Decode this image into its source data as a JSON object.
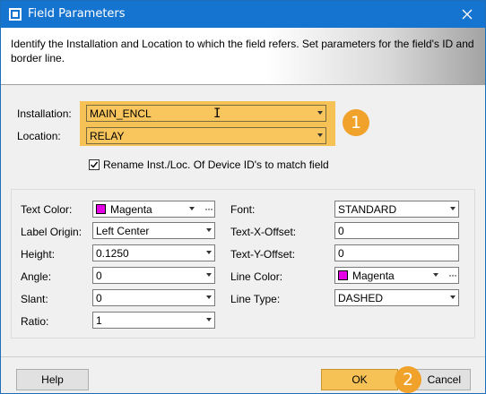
{
  "window": {
    "title": "Field Parameters",
    "description": "Identify the Installation and Location to which the field refers. Set parameters for the field's ID and border line."
  },
  "installation": {
    "label": "Installation:",
    "value": "MAIN_ENCL"
  },
  "location": {
    "label": "Location:",
    "value": "RELAY"
  },
  "rename_checkbox": {
    "label": "Rename Inst./Loc. Of Device ID's to match field",
    "checked": true
  },
  "callouts": {
    "first": "1",
    "second": "2"
  },
  "fields": {
    "text_color": {
      "label": "Text Color:",
      "value": "Magenta",
      "swatch": "#e600e6"
    },
    "label_origin": {
      "label": "Label Origin:",
      "value": "Left Center"
    },
    "height": {
      "label": "Height:",
      "value": "0.1250"
    },
    "angle": {
      "label": "Angle:",
      "value": "0"
    },
    "slant": {
      "label": "Slant:",
      "value": "0"
    },
    "ratio": {
      "label": "Ratio:",
      "value": "1"
    },
    "font": {
      "label": "Font:",
      "value": "STANDARD"
    },
    "text_x_offset": {
      "label": "Text-X-Offset:",
      "value": "0"
    },
    "text_y_offset": {
      "label": "Text-Y-Offset:",
      "value": "0"
    },
    "line_color": {
      "label": "Line Color:",
      "value": "Magenta",
      "swatch": "#e600e6"
    },
    "line_type": {
      "label": "Line Type:",
      "value": "DASHED"
    }
  },
  "footer": {
    "help": "Help",
    "ok": "OK",
    "cancel": "Cancel"
  },
  "colors": {
    "titlebar": "#1674d1",
    "highlight": "#f6c256",
    "badge": "#f0a22b"
  }
}
